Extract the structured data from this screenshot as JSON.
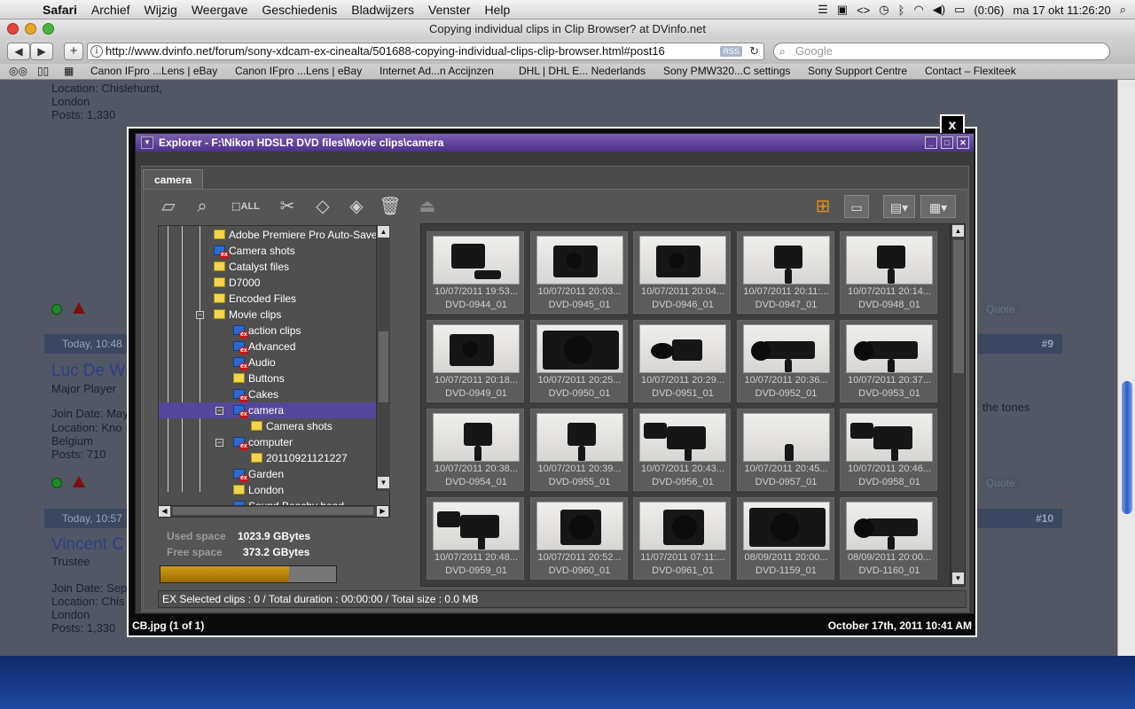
{
  "menubar": {
    "app": "Safari",
    "items": [
      "Archief",
      "Wijzig",
      "Weergave",
      "Geschiedenis",
      "Bladwijzers",
      "Venster",
      "Help"
    ],
    "battery": "(0:06)",
    "clock": "ma 17 okt  11:26:20"
  },
  "safari": {
    "title": "Copying individual clips in Clip Browser? at DVinfo.net",
    "url": "http://www.dvinfo.net/forum/sony-xdcam-ex-cinealta/501688-copying-individual-clips-clip-browser.html#post16",
    "rss": "RSS",
    "search_placeholder": "Google",
    "bookmarks": [
      "Canon IFpro ...Lens | eBay",
      "Canon IFpro ...Lens | eBay",
      "Internet Ad...n Accijnzen",
      "DHL | DHL E... Nederlands",
      "Sony PMW320...C settings",
      "Sony Support Centre",
      "Contact – Flexiteek"
    ]
  },
  "forum": {
    "top_location": "Location: Chislehurst,",
    "top_location2": "London",
    "top_posts": "Posts: 1,330",
    "post9_header": "Today, 10:48",
    "post9_num": "#9",
    "post9_name": "Luc De W",
    "post9_role": "Major Player",
    "post9_join": "Join Date: May",
    "post9_loc": "Location: Kno",
    "post9_country": "Belgium",
    "post9_posts": "Posts: 710",
    "post9_text": "the tones",
    "post10_header": "Today, 10:57",
    "post10_num": "#10",
    "post10_name": "Vincent C",
    "post10_role": "Trustee",
    "post10_join": "Join Date: Sep",
    "post10_loc": "Location: Chis",
    "post10_city": "London",
    "post10_posts": "Posts: 1,330",
    "quote": "Quote"
  },
  "lightbox": {
    "close": "x",
    "caption": "CB.jpg (1 of 1)",
    "date": "October 17th, 2011 10:41 AM"
  },
  "explorer": {
    "title": "Explorer - F:\\Nikon HDSLR DVD files\\Movie clips\\camera",
    "tab": "camera",
    "toolbar_all": "ALL",
    "tree": [
      {
        "label": "Adobe Premiere Pro Auto-Save",
        "level": 2,
        "type": "folder"
      },
      {
        "label": "Camera shots",
        "level": 2,
        "type": "ex"
      },
      {
        "label": "Catalyst files",
        "level": 2,
        "type": "folder"
      },
      {
        "label": "D7000",
        "level": 2,
        "type": "folder"
      },
      {
        "label": "Encoded Files",
        "level": 2,
        "type": "folder"
      },
      {
        "label": "Movie clips",
        "level": 2,
        "type": "folder",
        "expanded": true
      },
      {
        "label": "action clips",
        "level": 3,
        "type": "ex"
      },
      {
        "label": "Advanced",
        "level": 3,
        "type": "ex"
      },
      {
        "label": "Audio",
        "level": 3,
        "type": "ex"
      },
      {
        "label": "Buttons",
        "level": 3,
        "type": "folder"
      },
      {
        "label": "Cakes",
        "level": 3,
        "type": "ex"
      },
      {
        "label": "camera",
        "level": 3,
        "type": "ex",
        "expanded": true,
        "selected": true
      },
      {
        "label": "Camera shots",
        "level": 4,
        "type": "folder"
      },
      {
        "label": "computer",
        "level": 3,
        "type": "ex",
        "expanded": true
      },
      {
        "label": "20110921121227",
        "level": 4,
        "type": "folder"
      },
      {
        "label": "Garden",
        "level": 3,
        "type": "ex"
      },
      {
        "label": "London",
        "level": 3,
        "type": "folder"
      },
      {
        "label": "Sound Beachy head",
        "level": 3,
        "type": "ex"
      }
    ],
    "used_label": "Used space",
    "used_value": "1023.9 GBytes",
    "free_label": "Free space",
    "free_value": "373.2 GBytes",
    "used_fraction": 0.733,
    "clips": [
      {
        "date": "10/07/2011 19:53...",
        "name": "DVD-0944_01",
        "shot": "flat"
      },
      {
        "date": "10/07/2011 20:03...",
        "name": "DVD-0945_01",
        "shot": "back"
      },
      {
        "date": "10/07/2011 20:04...",
        "name": "DVD-0946_01",
        "shot": "back"
      },
      {
        "date": "10/07/2011 20:11:...",
        "name": "DVD-0947_01",
        "shot": "rig"
      },
      {
        "date": "10/07/2011 20:14...",
        "name": "DVD-0948_01",
        "shot": "rig"
      },
      {
        "date": "10/07/2011 20:18...",
        "name": "DVD-0949_01",
        "shot": "back"
      },
      {
        "date": "10/07/2011 20:25...",
        "name": "DVD-0950_01",
        "shot": "close"
      },
      {
        "date": "10/07/2011 20:29...",
        "name": "DVD-0951_01",
        "shot": "side"
      },
      {
        "date": "10/07/2011 20:36...",
        "name": "DVD-0952_01",
        "shot": "long"
      },
      {
        "date": "10/07/2011 20:37...",
        "name": "DVD-0953_01",
        "shot": "long"
      },
      {
        "date": "10/07/2011 20:38...",
        "name": "DVD-0954_01",
        "shot": "rig"
      },
      {
        "date": "10/07/2011 20:39...",
        "name": "DVD-0955_01",
        "shot": "rig"
      },
      {
        "date": "10/07/2011 20:43...",
        "name": "DVD-0956_01",
        "shot": "hand"
      },
      {
        "date": "10/07/2011 20:45...",
        "name": "DVD-0957_01",
        "shot": "empty"
      },
      {
        "date": "10/07/2011 20:46...",
        "name": "DVD-0958_01",
        "shot": "hand"
      },
      {
        "date": "10/07/2011 20:48...",
        "name": "DVD-0959_01",
        "shot": "hand"
      },
      {
        "date": "10/07/2011 20:52...",
        "name": "DVD-0960_01",
        "shot": "front"
      },
      {
        "date": "11/07/2011 07:11:...",
        "name": "DVD-0961_01",
        "shot": "front"
      },
      {
        "date": "08/09/2011 20:00...",
        "name": "DVD-1159_01",
        "shot": "close"
      },
      {
        "date": "08/09/2011 20:00...",
        "name": "DVD-1160_01",
        "shot": "long"
      }
    ],
    "status": "EX   Selected clips : 0 / Total duration : 00:00:00 / Total size : 0.0 MB"
  }
}
